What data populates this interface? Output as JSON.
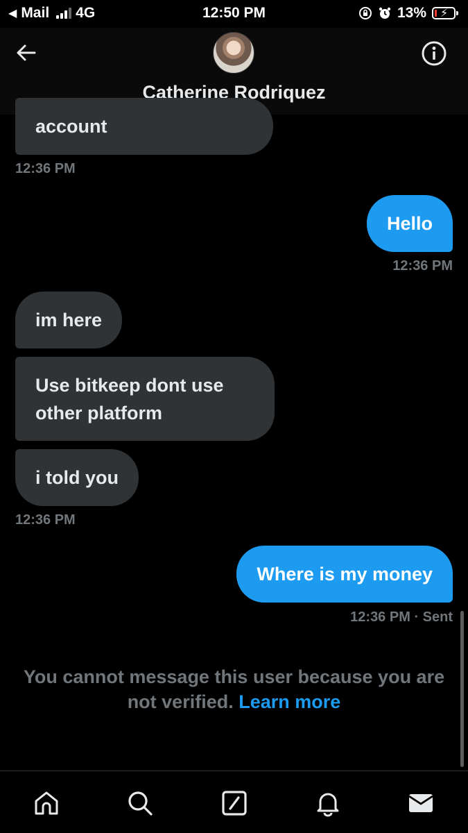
{
  "status_bar": {
    "carrier": "Mail",
    "network": "4G",
    "time": "12:50 PM",
    "battery": "13%",
    "battery_level": 0.13,
    "battery_color": "#ff3b30"
  },
  "header": {
    "contact_name": "Catherine Rodriquez",
    "back_icon": "arrow-left-icon",
    "info_icon": "info-icon"
  },
  "messages": [
    {
      "direction": "received",
      "text": "account",
      "time": "12:36 PM"
    },
    {
      "direction": "sent",
      "text": "Hello",
      "time": "12:36 PM"
    },
    {
      "direction": "received",
      "text": "im here"
    },
    {
      "direction": "received",
      "text": "Use bitkeep dont use other platform"
    },
    {
      "direction": "received",
      "text": "i told you",
      "time": "12:36 PM"
    },
    {
      "direction": "sent",
      "text": "Where is my money",
      "time": "12:36 PM",
      "status": "· Sent"
    }
  ],
  "notice": {
    "text": "You cannot message this user because you are not verified.",
    "link": "Learn more"
  },
  "bottom_nav": [
    "home-icon",
    "search-icon",
    "compose-icon",
    "notifications-icon",
    "messages-icon"
  ],
  "colors": {
    "background": "#000000",
    "received_bubble": "#2f3336",
    "sent_bubble": "#1d9bf0",
    "muted_text": "#71767b",
    "link": "#1d9bf0"
  }
}
